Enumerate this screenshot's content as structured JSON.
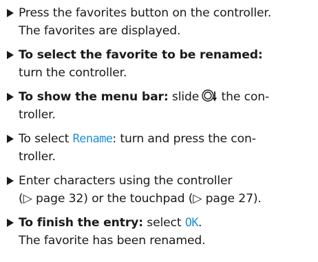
{
  "steps": [
    {
      "lines": [
        "Press the favorites button on the controller.",
        "The favorites are displayed."
      ]
    },
    {
      "lead": "To select the favorite to be renamed:",
      "text": "turn the controller."
    },
    {
      "lead": "To show the menu bar:",
      "pre": "slide",
      "icon": "controller-slide-down-icon",
      "text": "the con-",
      "text2": "troller."
    },
    {
      "pre": "To select",
      "ui": "Rename",
      "post": ": turn and press the con-",
      "post2": "troller."
    },
    {
      "line1": "Enter characters using the controller",
      "ref_a_arrow": "▷",
      "ref_a": "page 32",
      "mid": "or the touchpad",
      "ref_b_arrow": "▷",
      "ref_b": "page 27"
    },
    {
      "lead": "To finish the entry:",
      "pre": "select",
      "ui": "OK",
      "post": ".",
      "line2": "The favorite has been renamed."
    }
  ],
  "colors": {
    "text": "#1a1a1a",
    "ui_highlight": "#1e8fd6"
  }
}
